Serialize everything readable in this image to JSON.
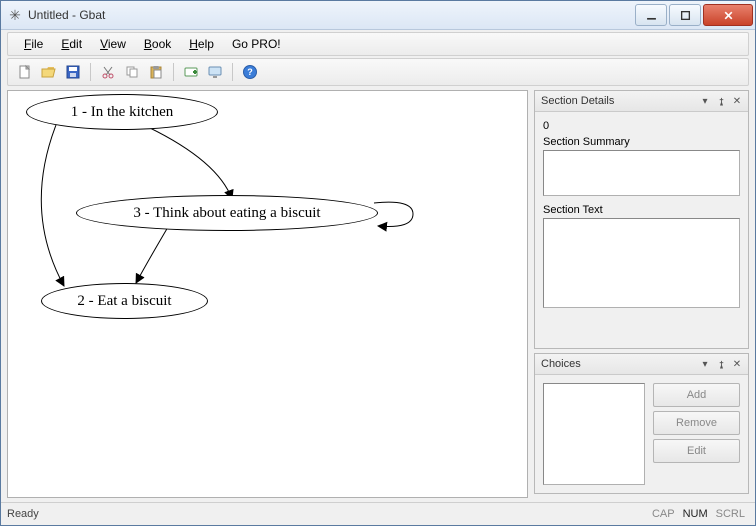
{
  "window": {
    "title": "Untitled - Gbat"
  },
  "menu": {
    "file": "File",
    "edit": "Edit",
    "view": "View",
    "book": "Book",
    "help": "Help",
    "gopro": "Go PRO!"
  },
  "toolbar_icons": {
    "new": "new",
    "open": "open",
    "save": "save",
    "cut": "cut",
    "copy": "copy",
    "paste": "paste",
    "node": "node",
    "screen": "screen",
    "help": "help"
  },
  "nodes": {
    "n1": "1 - In the kitchen",
    "n3": "3 - Think about eating a biscuit",
    "n2": "2 - Eat a biscuit"
  },
  "section_details": {
    "title": "Section Details",
    "id": "0",
    "summary_label": "Section Summary",
    "text_label": "Section Text",
    "summary": "",
    "text": ""
  },
  "choices": {
    "title": "Choices",
    "add": "Add",
    "remove": "Remove",
    "edit": "Edit"
  },
  "status": {
    "ready": "Ready",
    "cap": "CAP",
    "num": "NUM",
    "scrl": "SCRL"
  }
}
